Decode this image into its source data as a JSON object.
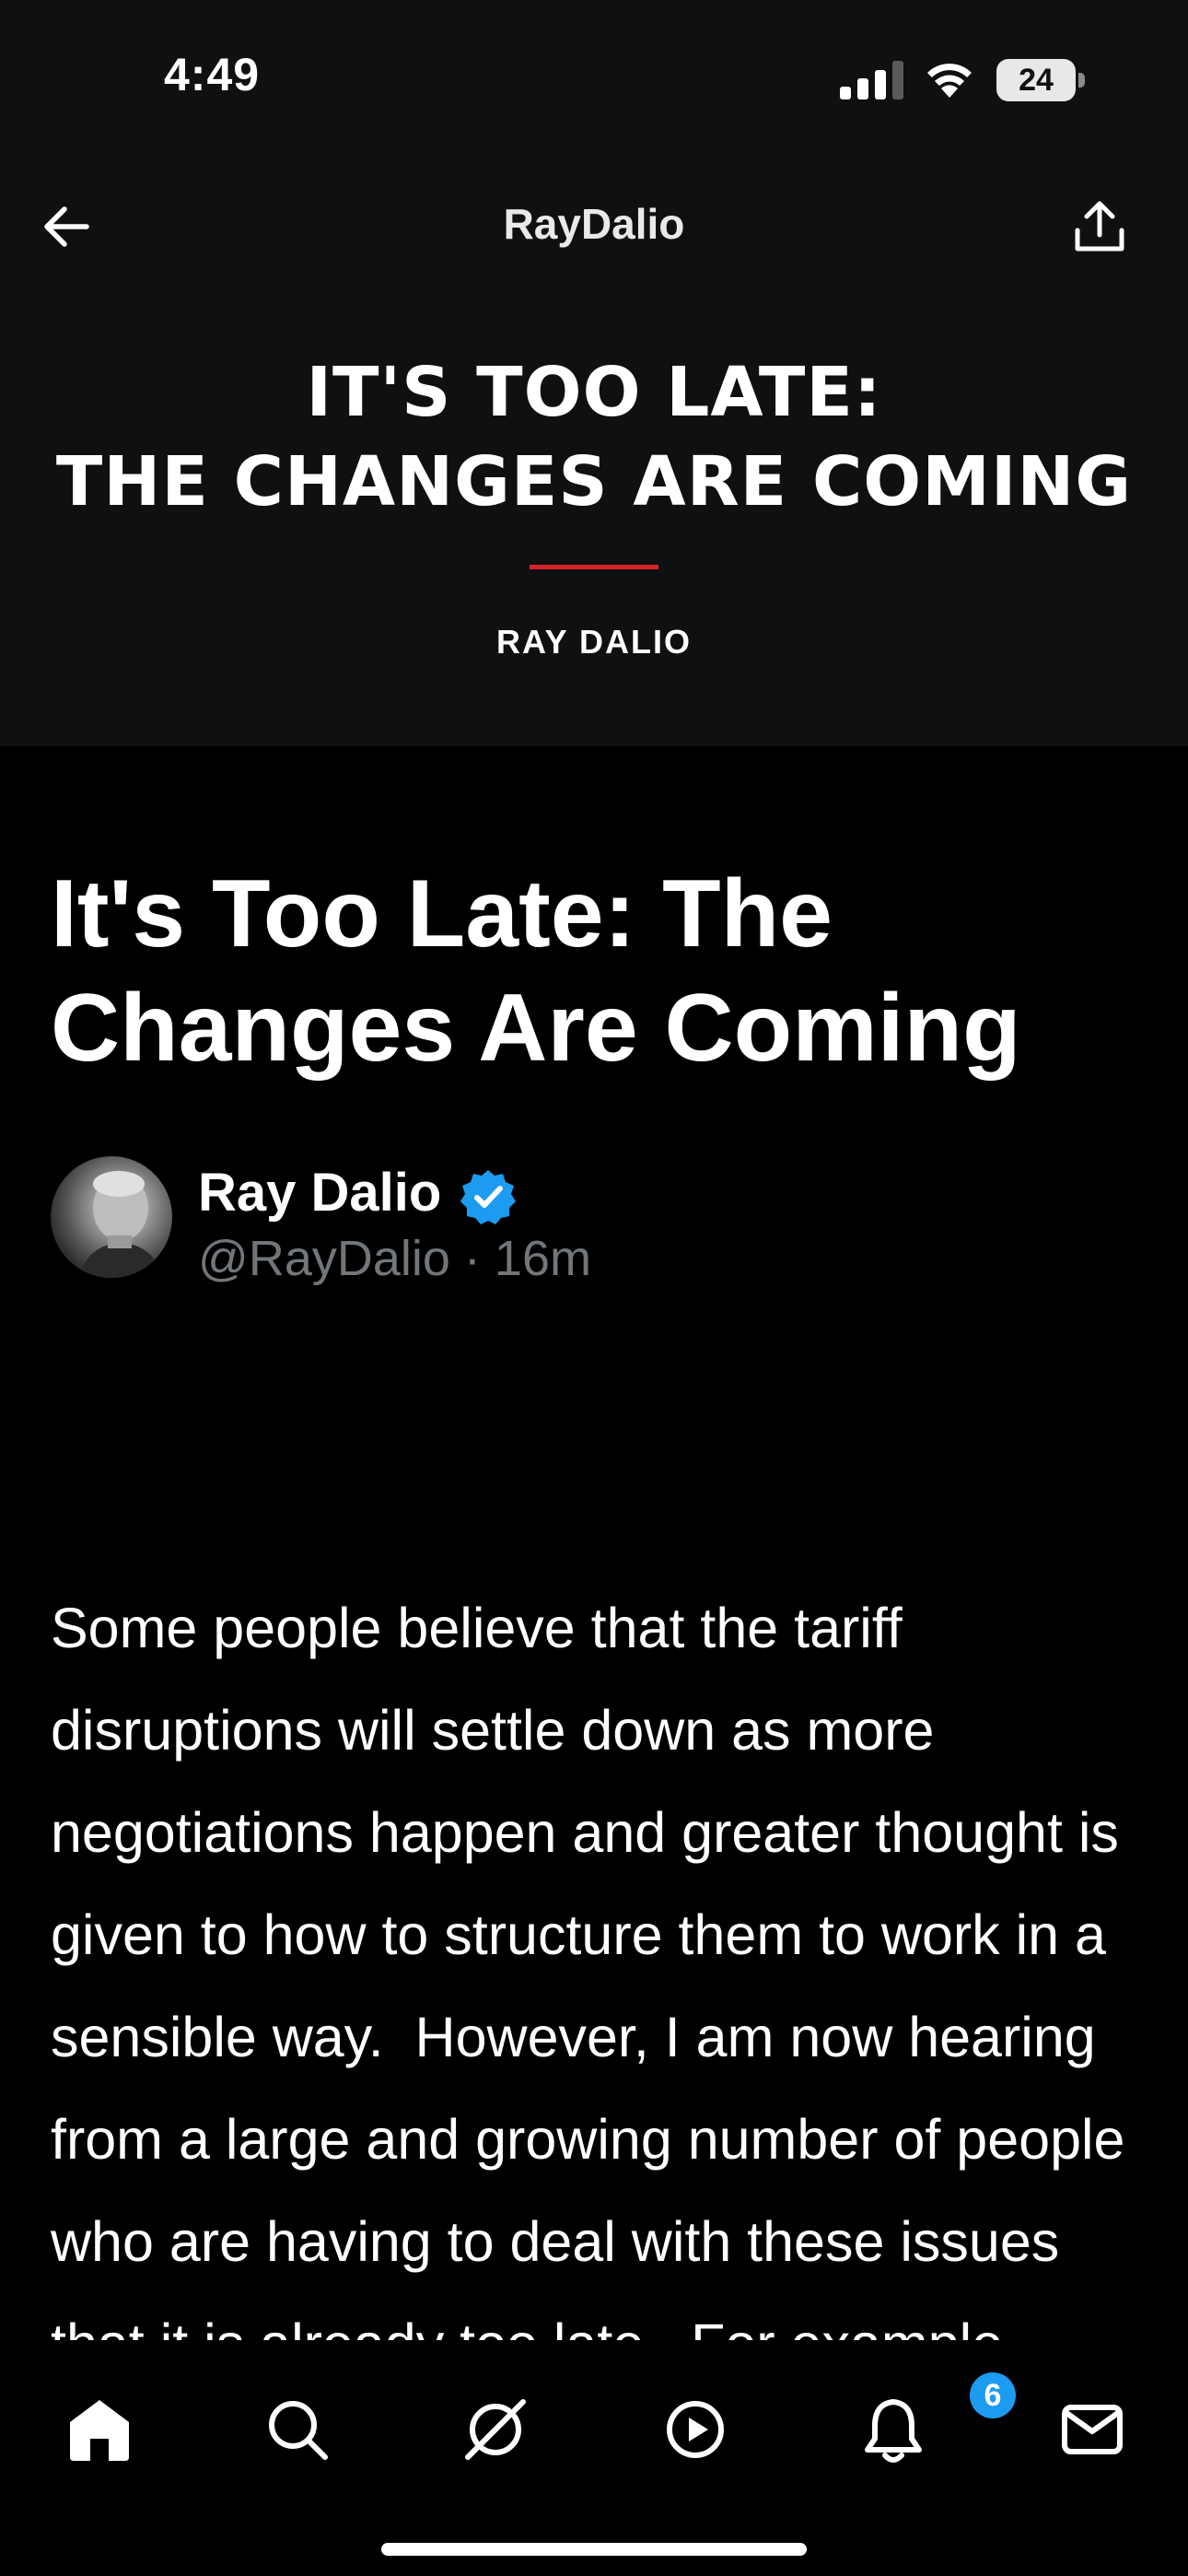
{
  "status_bar": {
    "time": "4:49",
    "battery_level": "24",
    "icons": [
      "signal-icon",
      "wifi-icon",
      "battery-icon"
    ]
  },
  "nav": {
    "title": "RayDalio",
    "back_icon": "arrow-left-icon",
    "share_icon": "share-icon"
  },
  "banner": {
    "line1": "IT'S TOO LATE:",
    "line2": "THE CHANGES ARE COMING",
    "author": "RAY DALIO",
    "rule_color": "#d6242b"
  },
  "article": {
    "title": "It's Too Late: The Changes Are Coming",
    "author_name": "Ray Dalio",
    "author_handle": "@RayDalio",
    "separator": "·",
    "timestamp": "16m",
    "body": "Some people believe that the tariff disruptions will settle down as more negotiations happen and greater thought is given to how to structure them to work in a sensible way.  However, I am now hearing from a large and growing number of people who are having to deal with these issues that it is already too late.  For example, many exporters to the"
  },
  "tab_bar": {
    "tabs": [
      "home-icon",
      "search-icon",
      "grok-icon",
      "video-icon",
      "notifications-icon",
      "messages-icon"
    ],
    "notification_count": "6",
    "badge_color": "#1d9bf0"
  }
}
